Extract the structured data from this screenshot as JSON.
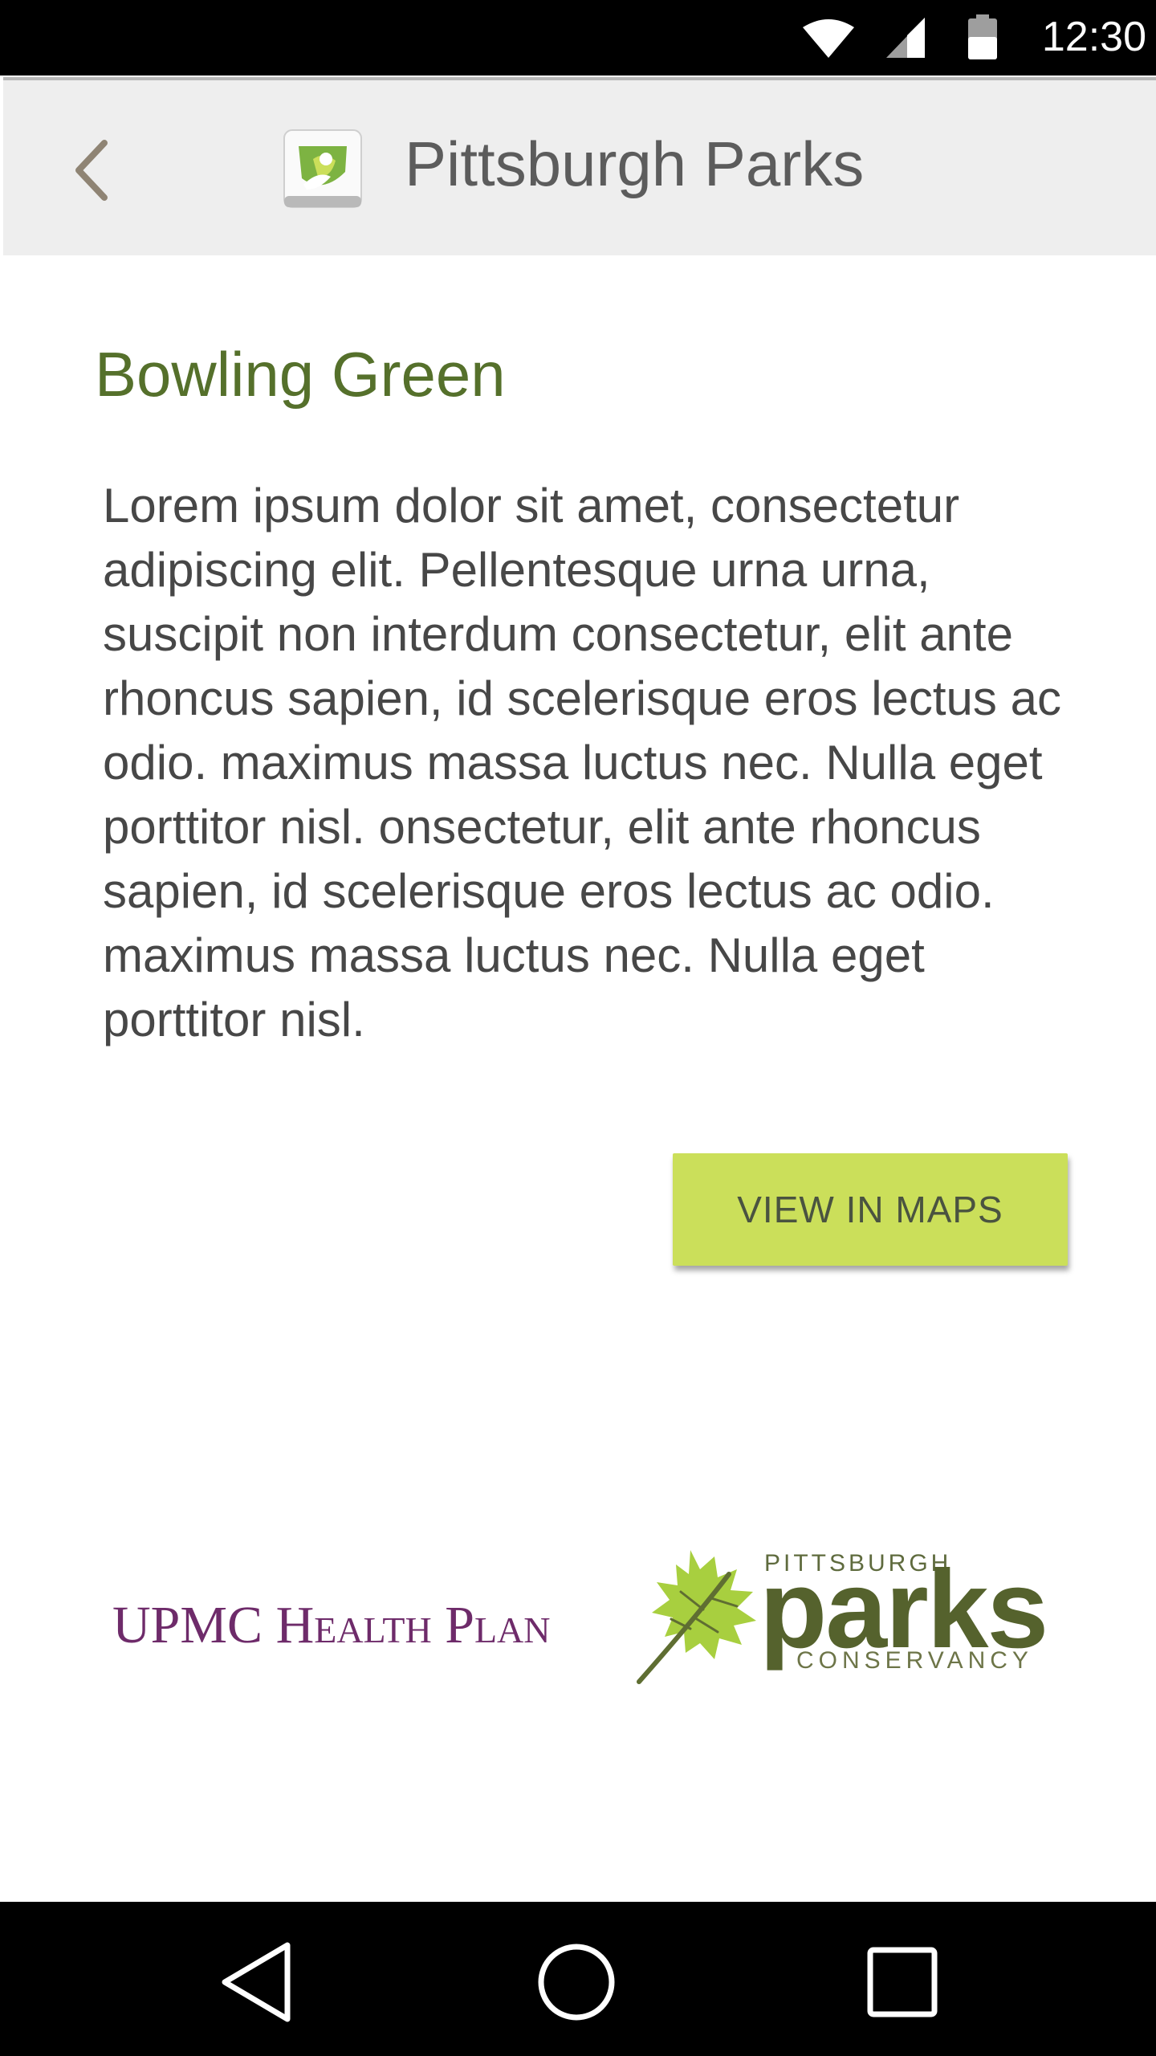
{
  "status_bar": {
    "time": "12:30",
    "icons": [
      "wifi-icon",
      "cellular-signal-icon",
      "battery-icon"
    ]
  },
  "app_bar": {
    "back_icon": "chevron-left-icon",
    "app_icon": "pittsburgh-parks-app-icon",
    "title": "Pittsburgh Parks"
  },
  "park": {
    "name": "Bowling Green",
    "description": "Lorem ipsum dolor sit amet, consectetur adipiscing elit. Pellentesque urna urna, suscipit non interdum consectetur, elit ante rhoncus sapien, id scelerisque eros lectus ac odio. maximus massa luctus nec. Nulla eget porttitor nisl. onsectetur, elit ante rhoncus sapien, id scelerisque eros lectus ac odio. maximus massa luctus nec. Nulla eget porttitor nisl."
  },
  "actions": {
    "view_in_maps": "VIEW IN MAPS"
  },
  "sponsors": {
    "upmc": {
      "part1": "UPMC ",
      "part2": "Health Plan"
    },
    "parks_conservancy": {
      "top": "PITTSBURGH",
      "main": "parks",
      "bottom": "CONSERVANCY"
    }
  },
  "nav_bar": {
    "icons": [
      "back-triangle-icon",
      "home-circle-icon",
      "recents-square-icon"
    ]
  },
  "colors": {
    "accent_green": "#55702b",
    "button_lime": "#cbdf5a",
    "upmc_purple": "#6e2b6a",
    "app_bar_bg": "#eeeeee"
  }
}
